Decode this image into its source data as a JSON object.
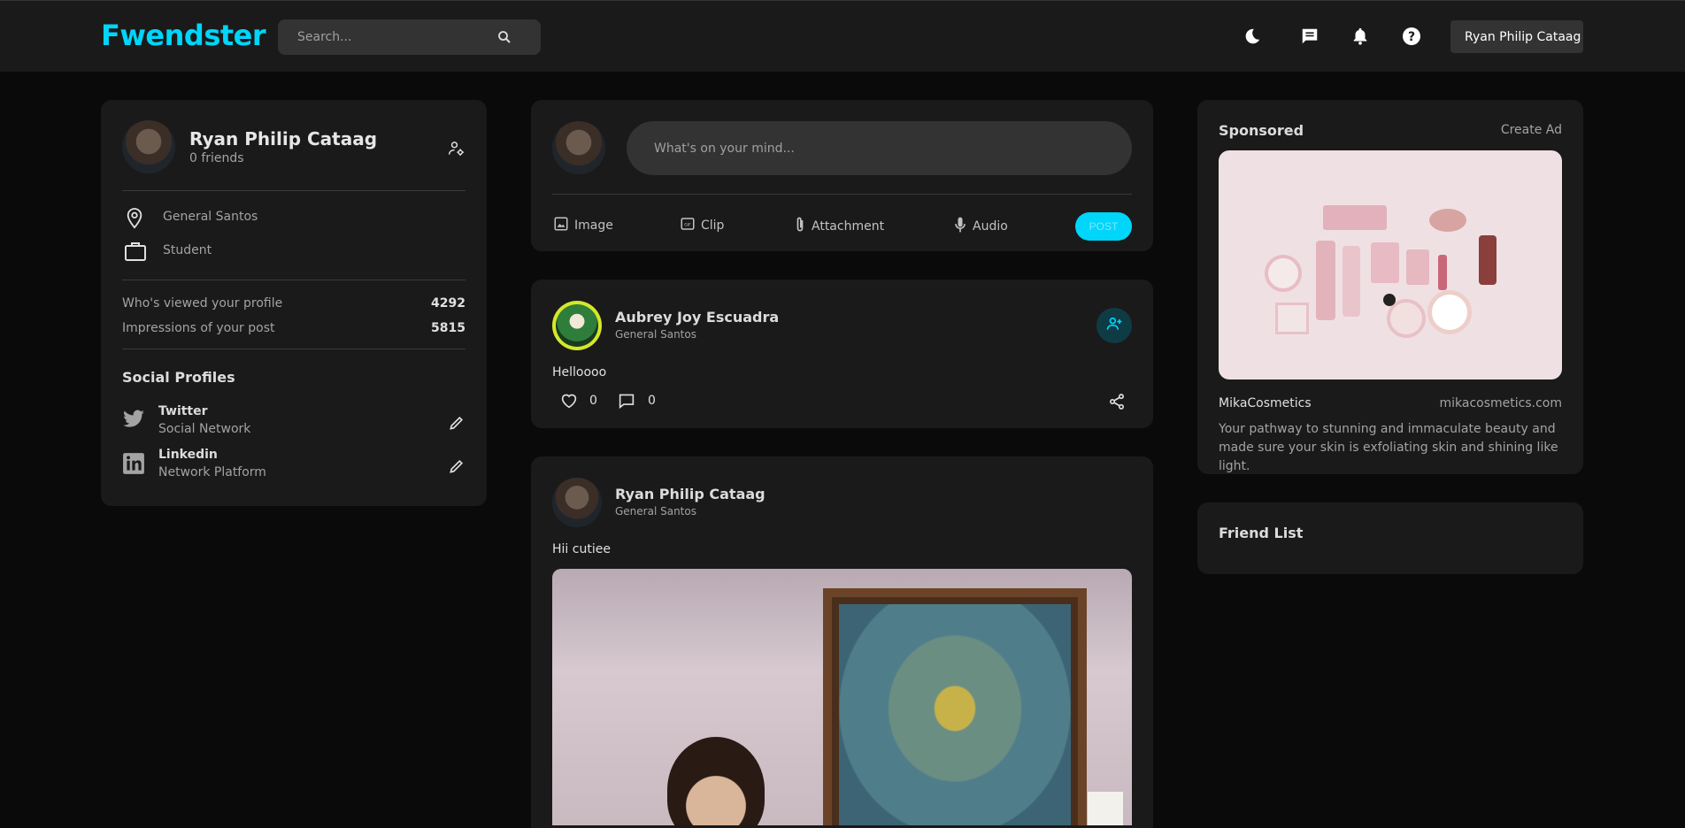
{
  "navbar": {
    "logo": "Fwendster",
    "search_placeholder": "Search...",
    "user_name": "Ryan Philip Cataag"
  },
  "profile": {
    "name": "Ryan Philip Cataag",
    "friends": "0 friends",
    "location": "General Santos",
    "occupation": "Student",
    "stats": [
      {
        "label": "Who's viewed your profile",
        "value": "4292"
      },
      {
        "label": "Impressions of your post",
        "value": "5815"
      }
    ],
    "social_title": "Social Profiles",
    "socials": [
      {
        "name": "Twitter",
        "sub": "Social Network"
      },
      {
        "name": "Linkedin",
        "sub": "Network Platform"
      }
    ]
  },
  "composer": {
    "placeholder": "What's on your mind...",
    "actions": [
      "Image",
      "Clip",
      "Attachment",
      "Audio"
    ],
    "post_label": "POST"
  },
  "posts": [
    {
      "author": "Aubrey Joy Escuadra",
      "location": "General Santos",
      "text": "Helloooo",
      "likes": "0",
      "comments": "0"
    },
    {
      "author": "Ryan Philip Cataag",
      "location": "General Santos",
      "text": "Hii cutiee"
    }
  ],
  "sponsored": {
    "title": "Sponsored",
    "create_ad": "Create Ad",
    "brand": "MikaCosmetics",
    "url": "mikacosmetics.com",
    "description": "Your pathway to stunning and immaculate beauty and made sure your skin is exfoliating skin and shining like light."
  },
  "friend_list": {
    "title": "Friend List"
  },
  "colors": {
    "accent": "#00d5fa",
    "background": "#0a0a0a",
    "card": "#1a1a1a"
  }
}
